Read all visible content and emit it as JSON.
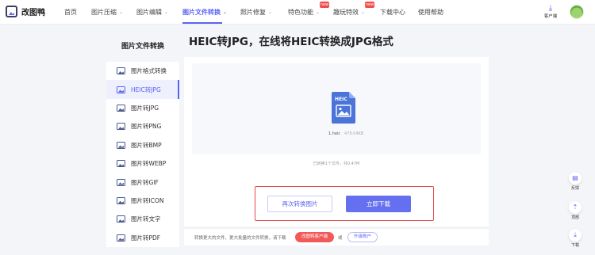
{
  "brand": {
    "name": "改图鸭"
  },
  "nav": {
    "items": [
      {
        "label": "首页",
        "has_menu": false
      },
      {
        "label": "图片压缩",
        "has_menu": true
      },
      {
        "label": "图片编辑",
        "has_menu": true
      },
      {
        "label": "图片文件转换",
        "has_menu": true,
        "active": true
      },
      {
        "label": "照片修复",
        "has_menu": true
      },
      {
        "label": "特色功能",
        "has_menu": true,
        "badge": "new"
      },
      {
        "label": "趣玩特效",
        "has_menu": true,
        "badge": "new"
      },
      {
        "label": "下载中心",
        "has_menu": false
      },
      {
        "label": "使用帮助",
        "has_menu": false
      }
    ],
    "chevron": "⌄",
    "client_label": "客户端",
    "client_icon": "download-icon"
  },
  "sidebar": {
    "title": "图片文件转换",
    "items": [
      {
        "label": "图片格式转换"
      },
      {
        "label": "HEIC转JPG",
        "active": true
      },
      {
        "label": "图片转JPG"
      },
      {
        "label": "图片转PNG"
      },
      {
        "label": "图片转BMP"
      },
      {
        "label": "图片转WEBP"
      },
      {
        "label": "图片转GIF"
      },
      {
        "label": "图片转ICON"
      },
      {
        "label": "图片转文字"
      },
      {
        "label": "图片转PDF"
      }
    ]
  },
  "main": {
    "title": "HEIC转JPG，在线将HEIC转换成JPG格式",
    "file": {
      "type_label": "HEIC",
      "name": "1.heic",
      "size": "479.04KB"
    },
    "convert_info": "已转换1个文件，共0.47M",
    "again_label": "再次转换图片",
    "download_label": "立即下载"
  },
  "footer": {
    "note": "转换更大的文件、更大批量的文件转换，请下载",
    "vip_label": "改图鸭客户端",
    "or_label": "或",
    "upgrade_label": "升级账户"
  },
  "float_tools": [
    {
      "label": "反馈",
      "icon": "feedback-icon"
    },
    {
      "label": "顶部",
      "icon": "back-to-top-icon"
    },
    {
      "label": "下载",
      "icon": "download-icon"
    }
  ],
  "colors": {
    "accent": "#5b63f2",
    "badge": "#f14c4c",
    "highlight_frame": "#e34a4a"
  }
}
